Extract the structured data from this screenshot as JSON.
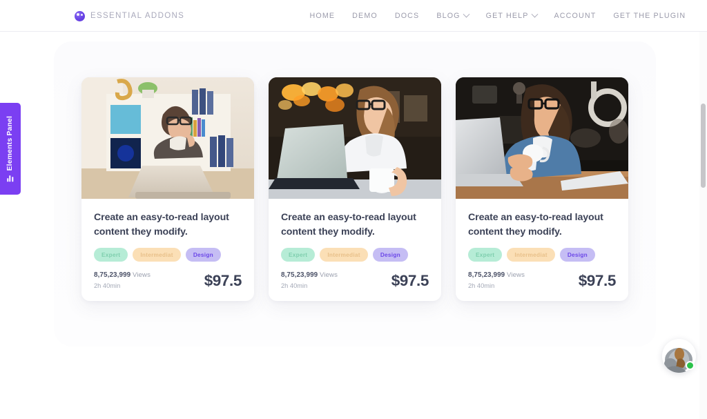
{
  "header": {
    "brand_name": "ESSENTIAL ADDONS",
    "logo_icon": "essential-addons-logo-icon",
    "nav": [
      {
        "label": "HOME",
        "has_dropdown": false
      },
      {
        "label": "DEMO",
        "has_dropdown": false
      },
      {
        "label": "DOCS",
        "has_dropdown": false
      },
      {
        "label": "BLOG",
        "has_dropdown": true,
        "dropdown_icon": "chevron-down-icon"
      },
      {
        "label": "GET HELP",
        "has_dropdown": true,
        "dropdown_icon": "chevron-down-icon"
      },
      {
        "label": "ACCOUNT",
        "has_dropdown": false
      },
      {
        "label": "GET THE PLUGIN",
        "has_dropdown": false
      }
    ]
  },
  "elements_panel": {
    "label": "Elements Panel",
    "icon": "bar-chart-icon",
    "background_color": "#7b3ff2"
  },
  "cards": [
    {
      "image_alt": "woman-sitting-on-floor-with-laptop",
      "title": "Create an easy-to-read layout content they modify.",
      "badges": [
        {
          "label": "Expert",
          "color": "#b6ecd6"
        },
        {
          "label": "Intermediat",
          "color": "#fbdfb6"
        },
        {
          "label": "Design",
          "color": "#c5bdf4"
        }
      ],
      "views_count": "8,75,23,999",
      "views_label": "Views",
      "duration": "2h 40min",
      "price": "$97.5"
    },
    {
      "image_alt": "woman-at-cafe-with-laptop-and-mug",
      "title": "Create an easy-to-read layout content they modify.",
      "badges": [
        {
          "label": "Expert",
          "color": "#b6ecd6"
        },
        {
          "label": "Intermediat",
          "color": "#fbdfb6"
        },
        {
          "label": "Design",
          "color": "#c5bdf4"
        }
      ],
      "views_count": "8,75,23,999",
      "views_label": "Views",
      "duration": "2h 40min",
      "price": "$97.5"
    },
    {
      "image_alt": "woman-holding-coffee-cup-at-laptop",
      "title": "Create an easy-to-read layout content they modify.",
      "badges": [
        {
          "label": "Expert",
          "color": "#b6ecd6"
        },
        {
          "label": "Intermediat",
          "color": "#fbdfb6"
        },
        {
          "label": "Design",
          "color": "#c5bdf4"
        }
      ],
      "views_count": "8,75,23,999",
      "views_label": "Views",
      "duration": "2h 40min",
      "price": "$97.5"
    }
  ],
  "chat_widget": {
    "avatar_icon": "support-agent-avatar",
    "status": "online",
    "status_color": "#2bc24a"
  }
}
